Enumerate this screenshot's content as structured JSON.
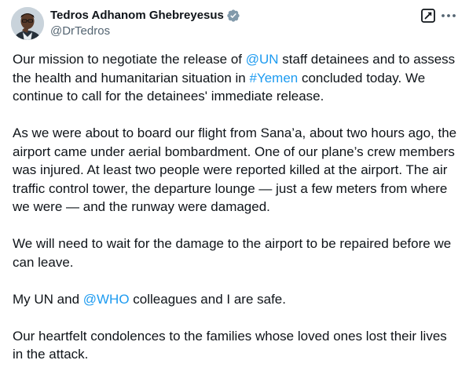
{
  "author": {
    "name": "Tedros Adhanom Ghebreyesus",
    "handle": "@DrTedros",
    "verified": true,
    "verified_color": "#829aab"
  },
  "actions": {
    "grok_icon": "grok-icon",
    "more_icon": "more-icon"
  },
  "colors": {
    "text": "#0f1419",
    "secondary": "#536471",
    "link": "#1d9bf0"
  },
  "tweet": {
    "p1": {
      "a": "Our mission to negotiate the release of ",
      "link1": "@UN",
      "b": " staff detainees and to assess the health and humanitarian situation in ",
      "link2": "#Yemen",
      "c": " concluded today. We continue to call for the detainees' immediate release."
    },
    "p2": "As we were about to board our flight from Sana’a, about two hours ago, the airport came under aerial bombardment. One of our plane’s crew members was injured. At least two people were reported killed at the airport. The air traffic control tower, the departure lounge — just a few meters from where we were — and the runway were damaged.",
    "p3": "We will need to wait for the damage to the airport to be repaired before we can leave.",
    "p4": {
      "a": "My UN and ",
      "link": "@WHO",
      "b": " colleagues and I are safe."
    },
    "p5": "Our heartfelt condolences to the families whose loved ones lost their lives in the attack."
  }
}
